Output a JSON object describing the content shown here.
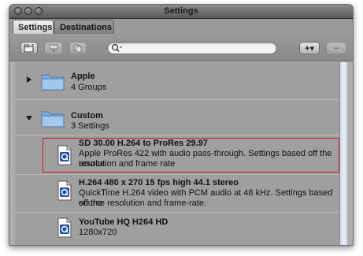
{
  "window": {
    "title": "Settings"
  },
  "tabs": [
    {
      "label": "Settings",
      "active": true
    },
    {
      "label": "Destinations",
      "active": false
    }
  ],
  "toolbar": {
    "icons": [
      "new-folder-icon",
      "apply-to-target-icon",
      "duplicate-icon",
      "add-menu-icon",
      "remove-icon"
    ],
    "add_label": "+▾",
    "remove_label": "−",
    "search": {
      "value": "",
      "placeholder": ""
    }
  },
  "groups": [
    {
      "name": "Apple",
      "count": "4 Groups",
      "expanded": false
    },
    {
      "name": "Custom",
      "count": "3 Settings",
      "expanded": true
    }
  ],
  "settings": [
    {
      "title": "SD 30.00 H.264 to ProRes 29.97",
      "line1": "Apple ProRes 422 with audio pass-through. Settings based off the source",
      "line2": "resolution and frame rate",
      "selected": true
    },
    {
      "title": "H.264 480 x 270 15 fps  high 44.1 stereo",
      "line1": "QuickTime H.264 video with PCM audio at 48 kHz. Settings based off the",
      "line2": "source resolution and frame-rate.",
      "selected": false
    },
    {
      "title": "YouTube HQ H264 HD",
      "line1": "1280x720",
      "line2": "",
      "selected": false
    }
  ],
  "colors": {
    "selection_outline": "#d7182a",
    "list_background": "#9f9f9f",
    "folder": "#7fb0e0"
  }
}
